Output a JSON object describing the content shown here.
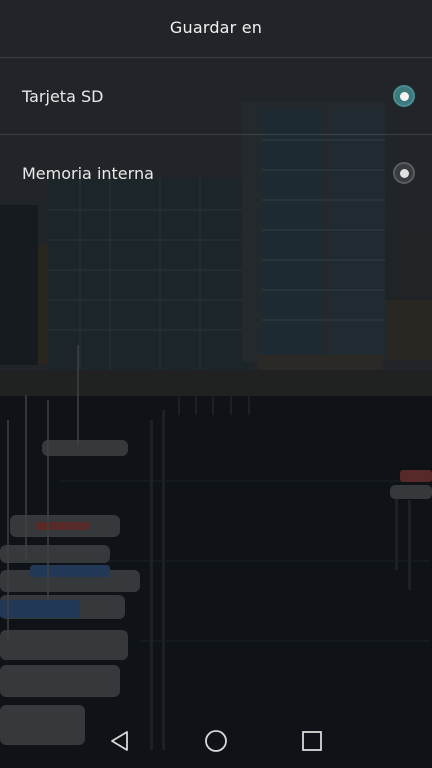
{
  "dialog": {
    "title": "Guardar en",
    "options": [
      {
        "label": "Tarjeta SD",
        "selected": true
      },
      {
        "label": "Memoria interna",
        "selected": false
      }
    ]
  },
  "colors": {
    "accent": "#3d7a7d",
    "text": "#e9e9e9"
  },
  "navbar": {
    "icons": [
      "back-icon",
      "home-icon",
      "recents-icon"
    ]
  }
}
